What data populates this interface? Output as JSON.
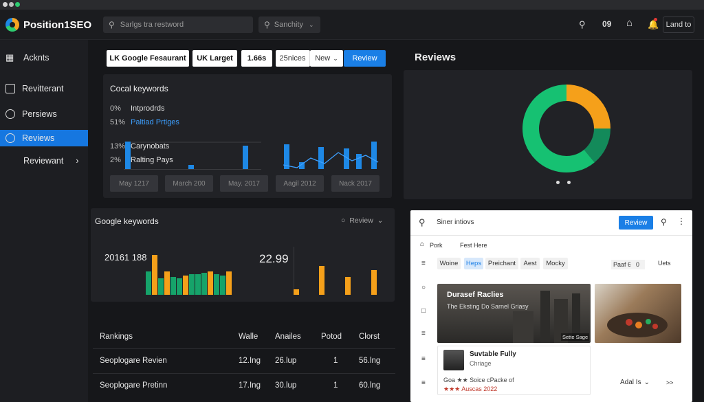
{
  "app": {
    "name": "Position1SEO"
  },
  "topbar": {
    "search_placeholder": "Sarlgs tra restword",
    "select_label": "Sanchity",
    "count": "09",
    "action_label": "Land to"
  },
  "sidebar": {
    "items": [
      {
        "label": "Acknts"
      },
      {
        "label": "Revitterant"
      },
      {
        "label": "Persiews"
      },
      {
        "label": "Reviews"
      },
      {
        "label": "Reviewant"
      }
    ]
  },
  "filters": {
    "chip1": "LK Google Fesaurant",
    "chip2": "UK Larget",
    "chip3": "1.66s",
    "chip4": "25nices",
    "chip5": "New",
    "review_button": "Review"
  },
  "local_keywords": {
    "title": "Cocal keywords",
    "rows": [
      {
        "pct": "0%",
        "label": "Intprodrds"
      },
      {
        "pct": "51%",
        "label": "Paltiad Prtiges"
      },
      {
        "pct": "13%",
        "label": "Carynobats"
      },
      {
        "pct": "2%",
        "label": "Ralting Pays"
      }
    ],
    "dates": [
      "May 1217",
      "March 200",
      "May. 2017",
      "Aagil 2012",
      "Nack 2017"
    ]
  },
  "google_keywords": {
    "title": "Google keywords",
    "review_label": "Review",
    "value1": "20161 188",
    "value2": "22.99"
  },
  "rankings": {
    "headers": [
      "Rankings",
      "Walle",
      "Anailes",
      "Potod",
      "Clorst"
    ],
    "rows": [
      [
        "Seoplogare Revien",
        "12.Ing",
        "26.lup",
        "1",
        "56.lng"
      ],
      [
        "Seoplogare Pretinn",
        "17.Ing",
        "30.lup",
        "1",
        "60.lng"
      ]
    ]
  },
  "reviews": {
    "title": "Reviews",
    "donut": [
      {
        "name": "orange",
        "value": 25,
        "color": "#f5a01a"
      },
      {
        "name": "dark-green",
        "value": 14,
        "color": "#138a5a"
      },
      {
        "name": "green",
        "value": 61,
        "color": "#16c172"
      }
    ]
  },
  "review_card": {
    "search_text": "Siner intiovs",
    "review_button": "Review",
    "nav1": "Pork",
    "nav2": "Fest Here",
    "pills": [
      "Woine",
      "Heps",
      "Preichant",
      "Aest",
      "Mocky"
    ],
    "sort_label": "Paaf 6",
    "sort_value": "0",
    "units": "Uets",
    "image1_title": "Durasef Raclies",
    "image1_sub": "The Eksting Do Sarnel Griasy",
    "image1_badge": "Sette Sage",
    "biz_name": "Suvtable Fully",
    "biz_sub": "Chriage",
    "biz_line": "Goa ★★ Soice cPacke of",
    "biz_date": "★★★ Auscas 2022",
    "add_label": "Adal Is",
    "more": ">>"
  },
  "colors": {
    "accent": "#1a7fe6",
    "orange": "#f5a01a",
    "green": "#16c172"
  }
}
